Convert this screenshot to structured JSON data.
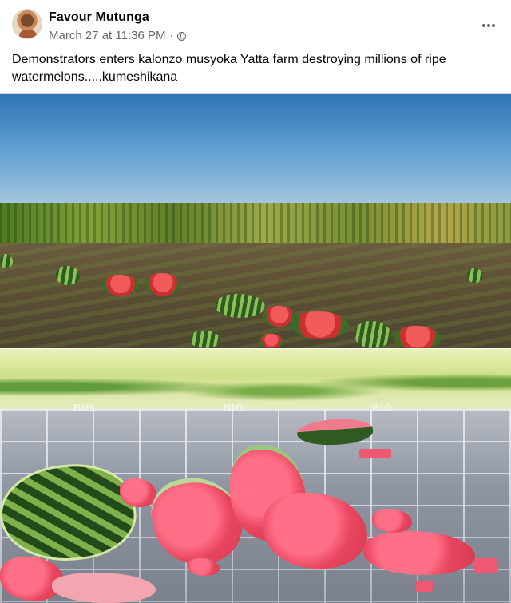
{
  "post": {
    "author": "Favour Mutunga",
    "timestamp": "March 27 at 11:36 PM",
    "separator": "·",
    "privacy_icon": "globe-icon",
    "more_icon": "more-options-icon",
    "text": "Demonstrators enters kalonzo musyoka Yatta farm destroying millions of ripe watermelons.....kumeshikana"
  },
  "photos": [
    {
      "description_icon": "photo-field-smashed-watermelons"
    },
    {
      "description_icon": "photo-pavement-smashed-watermelon",
      "watermark": "BIG"
    }
  ],
  "colors": {
    "text_primary": "#050505",
    "text_secondary": "#65676b"
  }
}
